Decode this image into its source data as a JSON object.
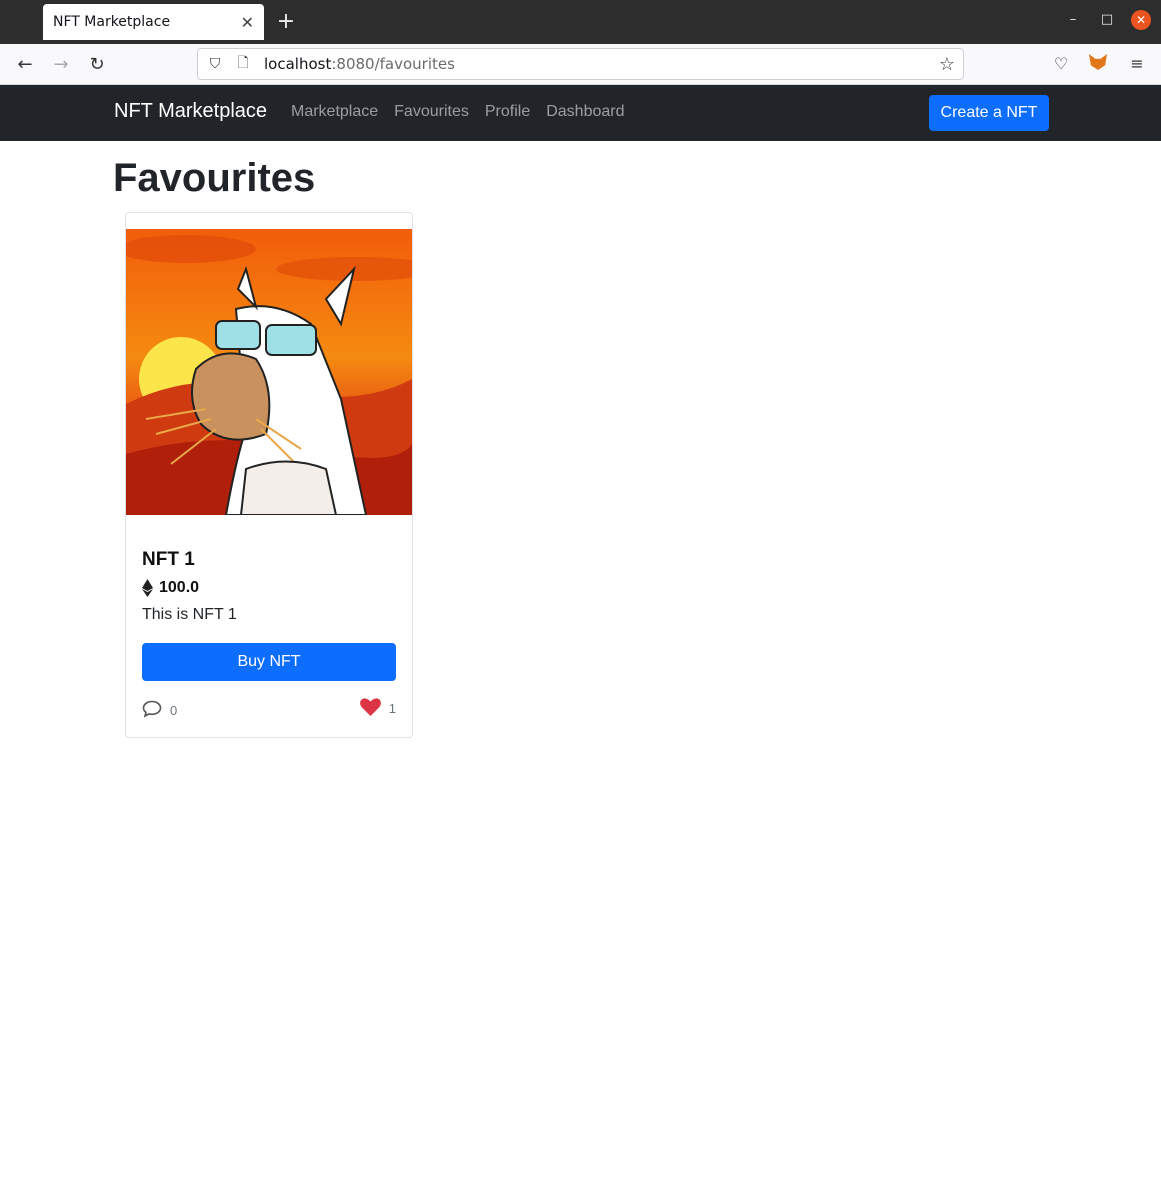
{
  "browser": {
    "tab_title": "NFT Marketplace",
    "url_host": "localhost",
    "url_rest": ":8080/favourites"
  },
  "navbar": {
    "brand": "NFT Marketplace",
    "links": [
      "Marketplace",
      "Favourites",
      "Profile",
      "Dashboard"
    ],
    "create_label": "Create a NFT"
  },
  "page": {
    "title": "Favourites"
  },
  "cards": [
    {
      "name": "NFT 1",
      "price": "100.0",
      "description": "This is NFT 1",
      "buy_label": "Buy NFT",
      "comments": "0",
      "likes": "1"
    }
  ],
  "colors": {
    "primary": "#0d6efd",
    "navbar_bg": "#212529",
    "like": "#dc3545"
  },
  "icons": [
    "back-icon",
    "forward-icon",
    "reload-icon",
    "shield-icon",
    "page-icon",
    "star-icon",
    "pocket-icon",
    "metamask-fox-icon",
    "menu-icon",
    "ethereum-icon",
    "comment-icon",
    "heart-icon"
  ]
}
